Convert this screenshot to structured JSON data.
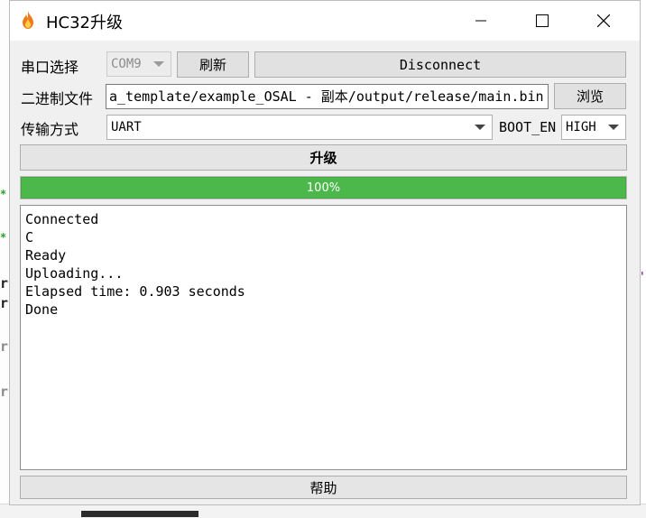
{
  "window": {
    "title": "HC32升级"
  },
  "serial": {
    "label": "串口选择",
    "port_value": "COM9",
    "refresh_label": "刷新",
    "disconnect_label": "Disconnect"
  },
  "binary": {
    "label": "二进制文件",
    "path_value": "a_template/example_OSAL - 副本/output/release/main.bin",
    "browse_label": "浏览"
  },
  "transfer": {
    "label": "传输方式",
    "mode_value": "UART",
    "boot_en_label": "BOOT_EN",
    "boot_en_value": "HIGH"
  },
  "upgrade_label": "升级",
  "progress": {
    "value": 100,
    "text": "100%"
  },
  "log_lines": [
    "Connected",
    "C",
    "Ready",
    "Uploading...",
    "Elapsed time: 0.903 seconds",
    "Done"
  ],
  "help_label": "帮助",
  "colors": {
    "progress_fill": "#4cb74a",
    "window_bg": "#f0f0f0"
  }
}
